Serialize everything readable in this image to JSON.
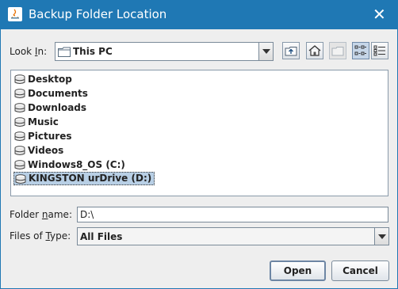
{
  "window": {
    "title": "Backup Folder Location"
  },
  "look_in": {
    "label_before": "Look ",
    "label_mnemonic": "I",
    "label_after": "n:",
    "selected": "This PC"
  },
  "toolbar": {
    "icons": [
      "up-folder-icon",
      "home-icon",
      "new-folder-icon",
      "list-view-icon",
      "details-view-icon"
    ]
  },
  "files": [
    {
      "label": "Desktop"
    },
    {
      "label": "Documents"
    },
    {
      "label": "Downloads"
    },
    {
      "label": "Music"
    },
    {
      "label": "Pictures"
    },
    {
      "label": "Videos"
    },
    {
      "label": "Windows8_OS (C:)"
    },
    {
      "label": "KINGSTON urDrive (D:)",
      "selected": true
    }
  ],
  "folder_name": {
    "label_before": "Folder ",
    "label_mnemonic": "n",
    "label_after": "ame:",
    "value": "D:\\"
  },
  "files_of_type": {
    "label_before": "Files of ",
    "label_mnemonic": "T",
    "label_after": "ype:",
    "selected": "All Files"
  },
  "buttons": {
    "open": "Open",
    "cancel": "Cancel"
  },
  "colors": {
    "titlebar": "#1f78b4",
    "selection": "#b8cfe5",
    "background": "#eeeeee"
  }
}
